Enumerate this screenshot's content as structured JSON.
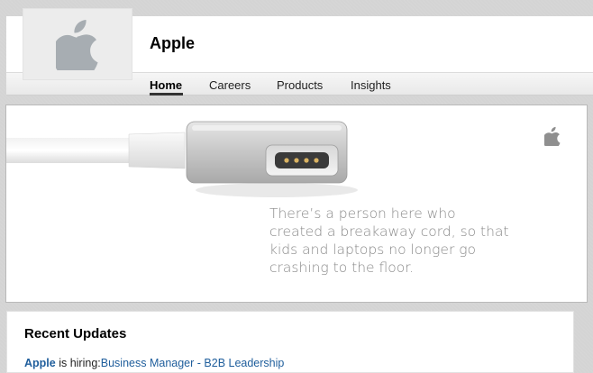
{
  "company": {
    "name": "Apple",
    "logo_icon": "apple-logo-icon"
  },
  "tabs": [
    {
      "label": "Home",
      "active": true
    },
    {
      "label": "Careers"
    },
    {
      "label": "Products"
    },
    {
      "label": "Insights"
    }
  ],
  "banner": {
    "text": "There’s a person here who created a breakaway cord, so that kids and laptops no longer go crashing to the floor.",
    "image": "magsafe-connector-image",
    "corner_logo": "apple-logo-icon"
  },
  "updates": {
    "title": "Recent Updates",
    "items": [
      {
        "company": "Apple",
        "verb": " is hiring:",
        "job": "Business Manager - B2B Leadership"
      }
    ]
  },
  "colors": {
    "link": "#1f5e9c",
    "logo_gray": "#a7adb2"
  }
}
